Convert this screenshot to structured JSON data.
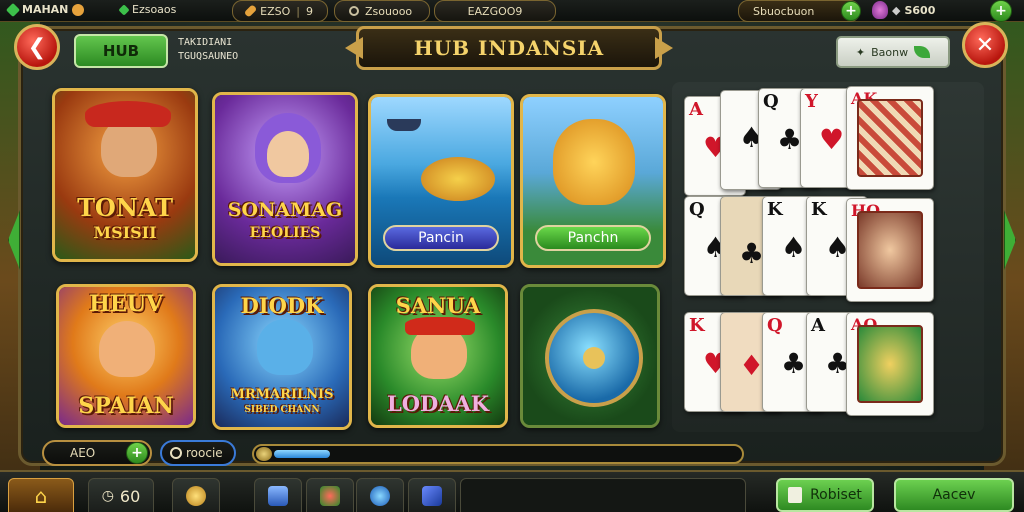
{
  "topbar": {
    "player_name": "MAHAN",
    "currency_1": "Ezsoaos",
    "currency_2": "EZSO",
    "currency_2_count": "9",
    "currency_3": "Zsouooo",
    "currency_4": "EAZGOO9",
    "right_label": "Sbuocbuon",
    "right_value": "S600"
  },
  "header": {
    "hub_button": "HUB",
    "hub_sub_line1": "TAKIDIANI",
    "hub_sub_line2": "TGUQSAUNEO",
    "title": "HUB INDANSIA",
    "browse_button": "Baonw"
  },
  "tiles": [
    {
      "title_line1": "TONAT",
      "title_line2": "MSISII"
    },
    {
      "title_line1": "SONAMAG",
      "title_line2": "EEOLIES"
    },
    {
      "pill": "Pancin"
    },
    {
      "pill": "Panchn"
    },
    {
      "title_line1": "HEUV",
      "title_line2": "SPAIAN"
    },
    {
      "title_line1": "DIODK",
      "title_line2": "MRMARILNIS",
      "title_line3": "SIBED CHANN"
    },
    {
      "title_line1": "SANUA",
      "title_line2": "LODAAK"
    },
    {
      "title_line1": ""
    }
  ],
  "cards": {
    "row1": [
      "A",
      "Q",
      "Y",
      "AK"
    ],
    "row2": [
      "Q",
      "K",
      "K",
      "HQ"
    ],
    "row3": [
      "K",
      "Q",
      "A",
      "AQ"
    ]
  },
  "footer_controls": {
    "field_1": "AEO",
    "field_2": "roocie",
    "progress": 0.12
  },
  "bottom_nav": {
    "timer": "60",
    "btn_1": "Robiset",
    "btn_2": "Aacev"
  },
  "colors": {
    "accent_gold": "#e1b64a",
    "action_green": "#4cb03a",
    "danger_red": "#c81e12"
  }
}
